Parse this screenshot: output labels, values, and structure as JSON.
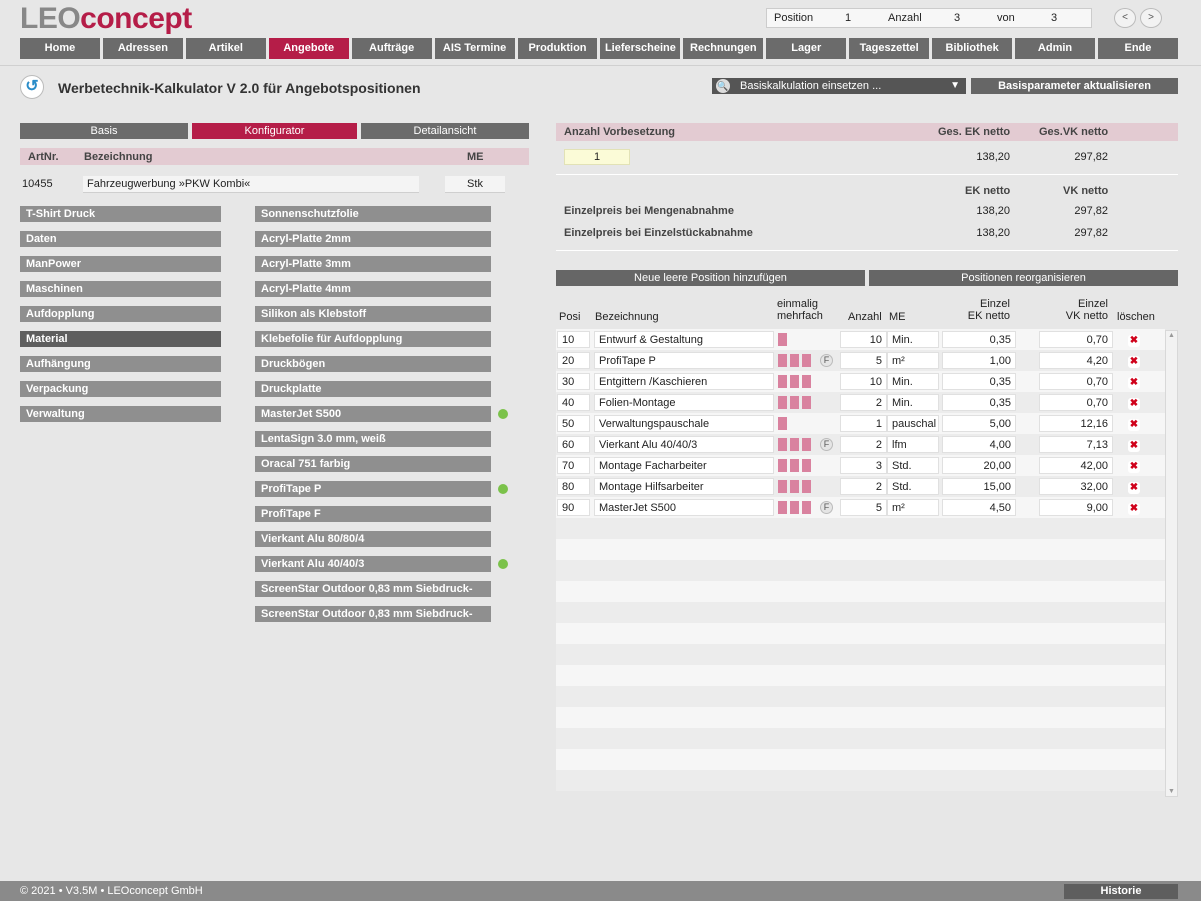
{
  "app": {
    "logo_prefix": "LEO",
    "logo_suffix": "concept"
  },
  "status": {
    "position_label": "Position",
    "position_value": "1",
    "count_label": "Anzahl",
    "count_value": "3",
    "of_label": "von",
    "of_value": "3",
    "prev": "<",
    "next": ">"
  },
  "nav": [
    "Home",
    "Adressen",
    "Artikel",
    "Angebote",
    "Aufträge",
    "AIS Termine",
    "Produktion",
    "Lieferscheine",
    "Rechnungen",
    "Lager",
    "Tageszettel",
    "Bibliothek",
    "Admin",
    "Ende"
  ],
  "nav_active": "Angebote",
  "page_title": "Werbetechnik-Kalkulator V 2.0 für Angebotspositionen",
  "dropdown": {
    "value": "Basiskalkulation einsetzen ..."
  },
  "update_button": "Basisparameter aktualisieren",
  "tabs": [
    "Basis",
    "Konfigurator",
    "Detailansicht"
  ],
  "tab_active": "Konfigurator",
  "article": {
    "head_artnr": "ArtNr.",
    "head_bez": "Bezeichnung",
    "head_me": "ME",
    "artnr": "10455",
    "bezeichnung": "Fahrzeugwerbung »PKW Kombi«",
    "me": "Stk"
  },
  "categories": [
    "T-Shirt Druck",
    "Daten",
    "ManPower",
    "Maschinen",
    "Aufdopplung",
    "Material",
    "Aufhängung",
    "Verpackung",
    "Verwaltung"
  ],
  "category_active": "Material",
  "materials": [
    {
      "name": "Sonnenschutzfolie",
      "dot": false
    },
    {
      "name": "Acryl-Platte 2mm",
      "dot": false
    },
    {
      "name": "Acryl-Platte 3mm",
      "dot": false
    },
    {
      "name": "Acryl-Platte 4mm",
      "dot": false
    },
    {
      "name": "Silikon als Klebstoff",
      "dot": false
    },
    {
      "name": "Klebefolie für Aufdopplung",
      "dot": false
    },
    {
      "name": "Druckbögen",
      "dot": false
    },
    {
      "name": "Druckplatte",
      "dot": false
    },
    {
      "name": "MasterJet S500",
      "dot": true
    },
    {
      "name": "LentaSign 3.0 mm, weiß",
      "dot": false
    },
    {
      "name": "Oracal 751 farbig",
      "dot": false
    },
    {
      "name": "ProfiTape P",
      "dot": true
    },
    {
      "name": "ProfiTape F",
      "dot": false
    },
    {
      "name": "Vierkant Alu 80/80/4",
      "dot": false
    },
    {
      "name": "Vierkant Alu 40/40/3",
      "dot": true
    },
    {
      "name": "ScreenStar Outdoor 0,83 mm Siebdruck-",
      "dot": false
    },
    {
      "name": "ScreenStar Outdoor 0,83 mm Siebdruck-",
      "dot": false
    }
  ],
  "summary": {
    "head_anzahl": "Anzahl Vorbesetzung",
    "head_ges_ek": "Ges. EK netto",
    "head_ges_vk": "Ges.VK netto",
    "anzahl": "1",
    "ges_ek": "138,20",
    "ges_vk": "297,82",
    "head_ek": "EK netto",
    "head_vk": "VK netto",
    "rows": [
      {
        "label": "Einzelpreis bei Mengenabnahme",
        "ek": "138,20",
        "vk": "297,82"
      },
      {
        "label": "Einzelpreis bei Einzelstückabnahme",
        "ek": "138,20",
        "vk": "297,82"
      }
    ]
  },
  "actions": {
    "add": "Neue leere Position hinzufügen",
    "reorg": "Positionen reorganisieren"
  },
  "grid_head": {
    "posi": "Posi",
    "bez": "Bezeichnung",
    "em1": "einmalig",
    "em2": "mehrfach",
    "anzahl": "Anzahl",
    "me": "ME",
    "ek1": "Einzel",
    "ek2": "EK netto",
    "vk1": "Einzel",
    "vk2": "VK netto",
    "del": "löschen"
  },
  "positions": [
    {
      "posi": "10",
      "bez": "Entwurf & Gestaltung",
      "squares": 1,
      "f": false,
      "anzahl": "10",
      "me": "Min.",
      "ek": "0,35",
      "vk": "0,70"
    },
    {
      "posi": "20",
      "bez": "ProfiTape P",
      "squares": 3,
      "f": true,
      "anzahl": "5",
      "me": "m²",
      "ek": "1,00",
      "vk": "4,20"
    },
    {
      "posi": "30",
      "bez": "Entgittern /Kaschieren",
      "squares": 3,
      "f": false,
      "anzahl": "10",
      "me": "Min.",
      "ek": "0,35",
      "vk": "0,70"
    },
    {
      "posi": "40",
      "bez": "Folien-Montage",
      "squares": 3,
      "f": false,
      "anzahl": "2",
      "me": "Min.",
      "ek": "0,35",
      "vk": "0,70"
    },
    {
      "posi": "50",
      "bez": "Verwaltungspauschale",
      "squares": 1,
      "f": false,
      "anzahl": "1",
      "me": "pauschal",
      "ek": "5,00",
      "vk": "12,16"
    },
    {
      "posi": "60",
      "bez": "Vierkant Alu 40/40/3",
      "squares": 3,
      "f": true,
      "anzahl": "2",
      "me": "lfm",
      "ek": "4,00",
      "vk": "7,13"
    },
    {
      "posi": "70",
      "bez": "Montage Facharbeiter",
      "squares": 3,
      "f": false,
      "anzahl": "3",
      "me": "Std.",
      "ek": "20,00",
      "vk": "42,00"
    },
    {
      "posi": "80",
      "bez": "Montage Hilfsarbeiter",
      "squares": 3,
      "f": false,
      "anzahl": "2",
      "me": "Std.",
      "ek": "15,00",
      "vk": "32,00"
    },
    {
      "posi": "90",
      "bez": "MasterJet S500",
      "squares": 3,
      "f": true,
      "anzahl": "5",
      "me": "m²",
      "ek": "4,50",
      "vk": "9,00"
    }
  ],
  "icons": {
    "f_badge": "F",
    "delete": "✖",
    "search": "🔍",
    "chevron": "▼",
    "back": "↺"
  },
  "footer": {
    "copyright": "© 2021 • V3.5M • LEOconcept GmbH",
    "historie": "Historie"
  }
}
